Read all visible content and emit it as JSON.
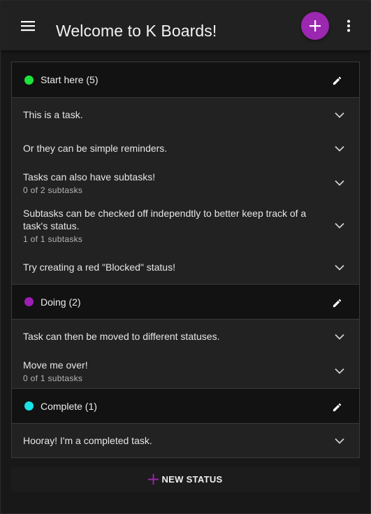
{
  "header": {
    "title": "Welcome to K Boards!",
    "accent": "#9c27b0",
    "icons": {
      "menu": "hamburger-icon",
      "add": "plus-icon",
      "more": "kebab-icon"
    }
  },
  "statuses": [
    {
      "name": "Start here (5)",
      "color": "#1de33b",
      "tasks": [
        {
          "text": "This is a task.",
          "sub": ""
        },
        {
          "text": "Or they can be simple reminders.",
          "sub": ""
        },
        {
          "text": "Tasks can also have subtasks!",
          "sub": "0 of 2 subtasks"
        },
        {
          "text": "Subtasks can be checked off independtly to better keep track of a task's status.",
          "sub": "1 of 1 subtasks"
        },
        {
          "text": "Try creating a red \"Blocked\" status!",
          "sub": ""
        }
      ]
    },
    {
      "name": "Doing (2)",
      "color": "#9c1eb5",
      "tasks": [
        {
          "text": "Task can then be moved to different statuses.",
          "sub": ""
        },
        {
          "text": "Move me over!",
          "sub": "0 of 1 subtasks"
        }
      ]
    },
    {
      "name": "Complete (1)",
      "color": "#18e3e6",
      "tasks": [
        {
          "text": "Hooray! I'm a completed task.",
          "sub": ""
        }
      ]
    }
  ],
  "footer": {
    "new_status_label": "NEW STATUS",
    "icon": "plus-icon"
  }
}
